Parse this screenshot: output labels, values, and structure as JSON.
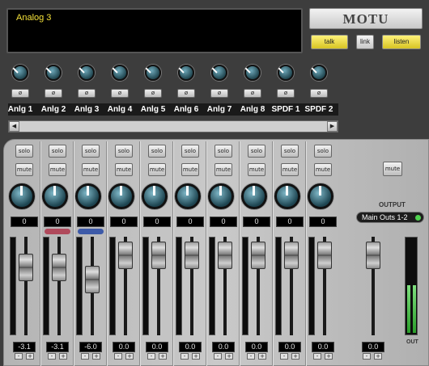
{
  "display_text": "Analog 3",
  "brand": "MOTU",
  "top_buttons": {
    "talk": "talk",
    "link": "link",
    "listen": "listen"
  },
  "phase_glyph": "ø",
  "inputs": [
    "Anlg 1",
    "Anlg 2",
    "Anlg 3",
    "Anlg 4",
    "Anlg 5",
    "Anlg 6",
    "Anlg 7",
    "Anlg 8",
    "SPDF 1",
    "SPDF 2"
  ],
  "scroll": {
    "left": "◀",
    "right": "▶"
  },
  "strip_buttons": {
    "solo": "solo",
    "mute": "mute"
  },
  "channels": [
    {
      "pan": "0",
      "level": "-3.1",
      "fader_db": -3.1,
      "tag_color": ""
    },
    {
      "pan": "0",
      "level": "-3.1",
      "fader_db": -3.1,
      "tag_color": "#b04a5c"
    },
    {
      "pan": "0",
      "level": "-6.0",
      "fader_db": -6.0,
      "tag_color": "#3d5aa8"
    },
    {
      "pan": "0",
      "level": "0.0",
      "fader_db": 0.0,
      "tag_color": ""
    },
    {
      "pan": "0",
      "level": "0.0",
      "fader_db": 0.0,
      "tag_color": ""
    },
    {
      "pan": "0",
      "level": "0.0",
      "fader_db": 0.0,
      "tag_color": ""
    },
    {
      "pan": "0",
      "level": "0.0",
      "fader_db": 0.0,
      "tag_color": ""
    },
    {
      "pan": "0",
      "level": "0.0",
      "fader_db": 0.0,
      "tag_color": ""
    },
    {
      "pan": "0",
      "level": "0.0",
      "fader_db": 0.0,
      "tag_color": ""
    },
    {
      "pan": "0",
      "level": "0.0",
      "fader_db": 0.0,
      "tag_color": ""
    }
  ],
  "pm": {
    "minus": "-",
    "plus": "+"
  },
  "output": {
    "mute": "mute",
    "label": "OUTPUT",
    "select": "Main Outs 1-2",
    "level": "0.0",
    "meter_label": "OUT",
    "meter_fill": 0.5
  },
  "colors": {
    "display_text": "#f5e23a",
    "meter_green": "#3ccf3c",
    "knob": "#2f6674"
  }
}
